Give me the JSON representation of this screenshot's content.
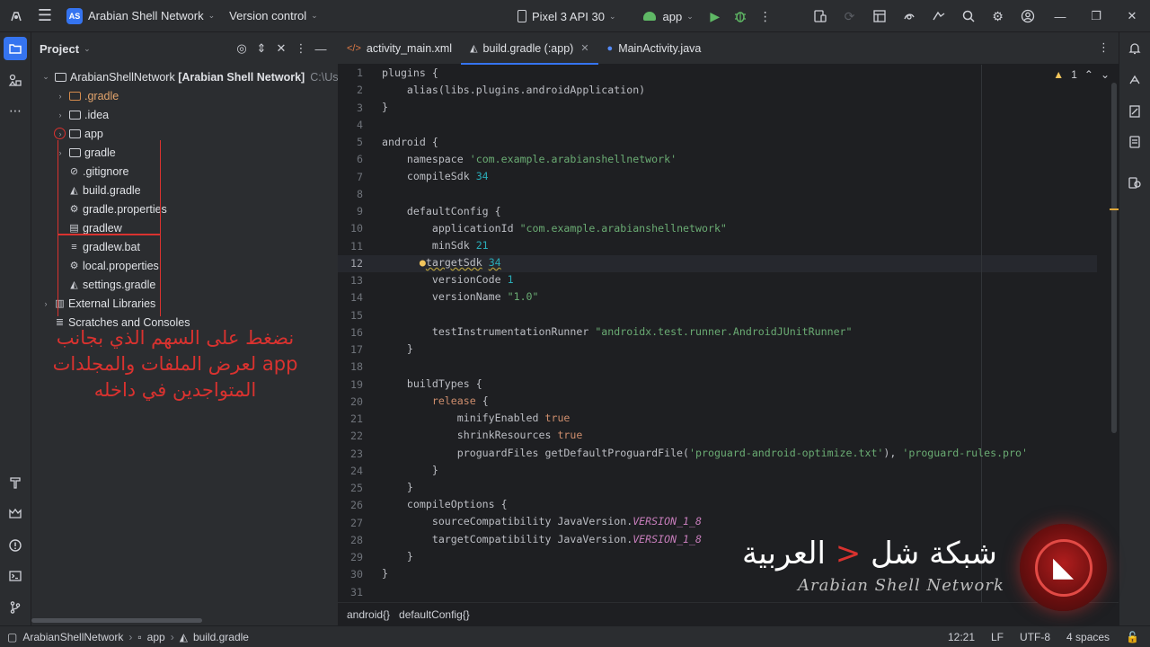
{
  "titlebar": {
    "project_badge": "AS",
    "project_name": "Arabian Shell Network",
    "version_control": "Version control",
    "device": "Pixel 3 API 30",
    "run_config": "app",
    "colors": {
      "accent": "#3574f0",
      "run": "#5fb865"
    }
  },
  "project_panel": {
    "title": "Project",
    "tree": [
      {
        "label": "ArabianShellNetwork",
        "bold_label": "[Arabian Shell Network]",
        "hint": "C:\\Users\\",
        "icon": "module-folder-icon",
        "expanded": true
      },
      {
        "label": ".gradle",
        "icon": "folder-icon",
        "orange": true
      },
      {
        "label": ".idea",
        "icon": "folder-icon"
      },
      {
        "label": "app",
        "icon": "module-folder-icon"
      },
      {
        "label": "gradle",
        "icon": "folder-icon"
      },
      {
        "label": ".gitignore",
        "icon": "ignore-file-icon"
      },
      {
        "label": "build.gradle",
        "icon": "gradle-file-icon"
      },
      {
        "label": "gradle.properties",
        "icon": "settings-file-icon"
      },
      {
        "label": "gradlew",
        "icon": "script-file-icon"
      },
      {
        "label": "gradlew.bat",
        "icon": "text-file-icon"
      },
      {
        "label": "local.properties",
        "icon": "settings-file-icon"
      },
      {
        "label": "settings.gradle",
        "icon": "gradle-file-icon"
      },
      {
        "label": "External Libraries",
        "icon": "library-icon"
      },
      {
        "label": "Scratches and Consoles",
        "icon": "scratch-icon"
      }
    ],
    "annotation": "نضغط على السهم الذي بجانب app لعرض الملفات والمجلدات المتواجدين في داخله"
  },
  "tabs": [
    {
      "label": "activity_main.xml",
      "icon": "xml-icon",
      "active": false
    },
    {
      "label": "build.gradle (:app)",
      "icon": "gradle-icon",
      "active": true
    },
    {
      "label": "MainActivity.java",
      "icon": "class-icon",
      "active": false
    }
  ],
  "editor": {
    "inspection_count": "1",
    "current_line": 12,
    "lines": [
      "1",
      "2",
      "3",
      "4",
      "5",
      "6",
      "7",
      "8",
      "9",
      "10",
      "11",
      "12",
      "13",
      "14",
      "15",
      "16",
      "17",
      "18",
      "19",
      "20",
      "21",
      "22",
      "23",
      "24",
      "25",
      "26",
      "27",
      "28",
      "29",
      "30",
      "31"
    ]
  },
  "breadcrumbs": [
    "android{}",
    "defaultConfig{}"
  ],
  "statusbar": {
    "crumbs": [
      "ArabianShellNetwork",
      "app",
      "build.gradle"
    ],
    "position": "12:21",
    "line_sep": "LF",
    "encoding": "UTF-8",
    "indent": "4 spaces"
  },
  "watermark": {
    "arabic_pre": "شبكة شل",
    "arabic_mark": "<",
    "arabic_post": "العربية",
    "english": "Arabian Shell Network"
  }
}
